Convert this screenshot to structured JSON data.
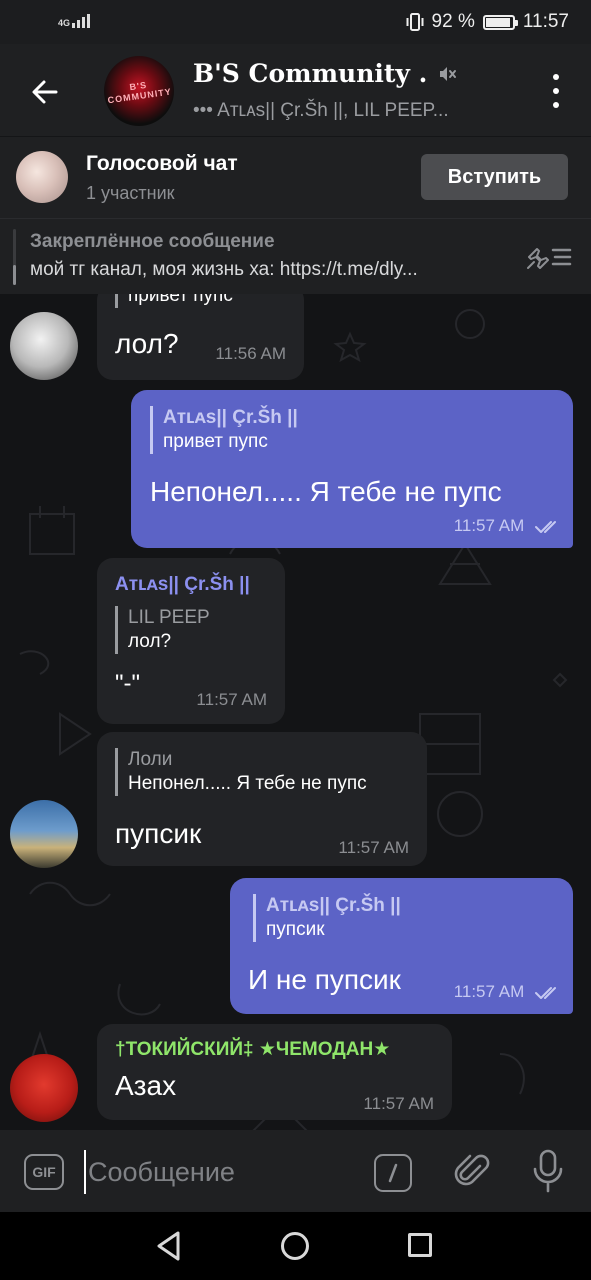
{
  "status_bar": {
    "network": "4G",
    "battery": "92 %",
    "battery_level": 0.92,
    "time": "11:57"
  },
  "header": {
    "title": "B'S Community .",
    "subtitle": "••• Aтʟᴀs|| Çr.Šh ||, LIL PEEP...",
    "avatar_text": "B'S COMMUNITY"
  },
  "voice_chat": {
    "title": "Голосовой чат",
    "participants": "1 участник",
    "join_label": "Вступить"
  },
  "pinned": {
    "title": "Закреплённое сообщение",
    "text": "мой тг канал, моя жизнь ха: https://t.me/dly..."
  },
  "messages": [
    {
      "direction": "in",
      "reply_text": "привет пупс",
      "text": "лол?",
      "time": "11:56 AM"
    },
    {
      "direction": "out",
      "reply_name": "Aтʟᴀs|| Çr.Šh ||",
      "reply_text": "привет пупс",
      "text": "Непонел..... Я тебе не пупс",
      "time": "11:57 AM"
    },
    {
      "direction": "in",
      "sender": "Aтʟᴀs|| Çr.Šh ||",
      "reply_name": "LIL PEEP",
      "reply_text": "лол?",
      "text": "\"-\"",
      "time": "11:57 AM"
    },
    {
      "direction": "in",
      "reply_name": "Лоли",
      "reply_text": "Непонел..... Я тебе не пупс",
      "text": "пупсик",
      "time": "11:57 AM"
    },
    {
      "direction": "out",
      "reply_name": "Aтʟᴀs|| Çr.Šh ||",
      "reply_text": "пупсик",
      "text": "И не пупсик",
      "time": "11:57 AM"
    },
    {
      "direction": "in",
      "sender": "†ТОКИЙСКИЙ‡ ★ЧЕМОДАН★",
      "text": "Азах",
      "time": "11:57 AM"
    }
  ],
  "input": {
    "placeholder": "Сообщение",
    "gif_label": "GIF"
  },
  "colors": {
    "outgoing_bubble": "#5c63c6",
    "incoming_bubble": "#222326",
    "reply_accent_out": "#c6c9f2",
    "name_purple": "#8c90f0",
    "name_green": "#8fe56a",
    "reply_gray": "#9a9ca0"
  },
  "icons": [
    "back-arrow-icon",
    "mute-icon",
    "more-vert-icon",
    "unpin-icon",
    "double-check-icon",
    "gif-icon",
    "command-icon",
    "paperclip-icon",
    "microphone-icon",
    "nav-back-icon",
    "nav-home-icon",
    "nav-recents-icon"
  ]
}
